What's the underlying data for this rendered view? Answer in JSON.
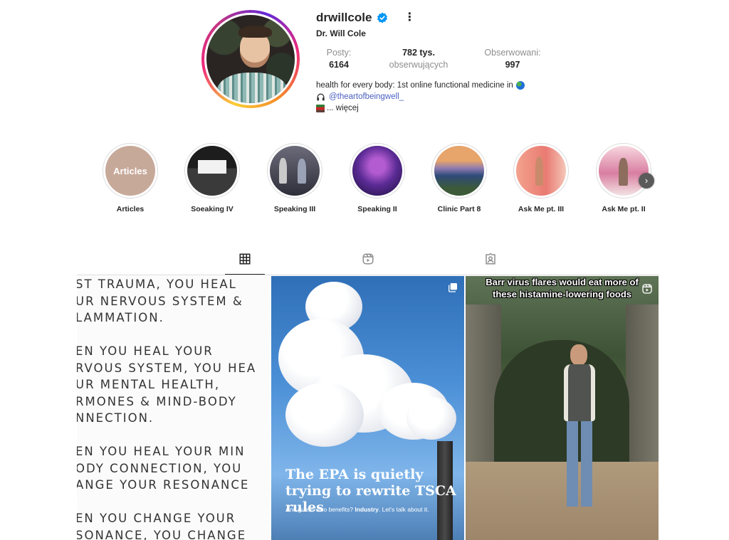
{
  "profile": {
    "username": "drwillcole",
    "full_name": "Dr. Will Cole",
    "more_label": "•••"
  },
  "stats": {
    "posts_label": "Posty:",
    "posts_value": "6164",
    "followers_value": "782 tys.",
    "followers_label": "obserwujących",
    "following_label": "Obserwowani:",
    "following_value": "997"
  },
  "bio": {
    "line1": "health for every body: 1st online functional medicine in",
    "link": "@theartofbeingwell_",
    "more": "... więcej"
  },
  "highlights": [
    {
      "label": "Articles",
      "cover_text": "Articles"
    },
    {
      "label": "Soeaking IV"
    },
    {
      "label": "Speaking III"
    },
    {
      "label": "Speaking II"
    },
    {
      "label": "Clinic Part 8"
    },
    {
      "label": "Ask Me pt. III"
    },
    {
      "label": "Ask Me pt. II"
    }
  ],
  "highlights_next_icon": "chevron-right-icon",
  "tabs": [
    {
      "name": "posts",
      "icon": "grid-icon",
      "active": true
    },
    {
      "name": "reels",
      "icon": "reels-icon",
      "active": false
    },
    {
      "name": "tagged",
      "icon": "tagged-icon",
      "active": false
    }
  ],
  "posts": [
    {
      "type": "image",
      "text": "ST TRAUMA, YOU HEAL\nUR NERVOUS SYSTEM &\nLAMMATION.\n\nEN YOU HEAL YOUR\nRVOUS SYSTEM, YOU HEA\nUR MENTAL HEALTH,\nRMONES & MIND-BODY\nNNECTION.\n\nEN YOU HEAL YOUR MIN\nODY CONNECTION, YOU\nANGE YOUR RESONANCE\n\nEN YOU CHANGE YOUR\nSONANCE, YOU CHANGE"
    },
    {
      "type": "carousel",
      "headline": "The EPA is quietly trying to rewrite TSCA rules",
      "sub_prefix": "And guess who benefits? ",
      "sub_bold": "Industry",
      "sub_suffix": ". Let's talk about it."
    },
    {
      "type": "reel",
      "caption_line1": "Barr virus flares would eat more of",
      "caption_line2": "these histamine-lowering foods"
    }
  ],
  "colors": {
    "verified": "#0095f6",
    "link": "#4a5fc1",
    "muted": "#8e8e8e",
    "text": "#262626"
  }
}
